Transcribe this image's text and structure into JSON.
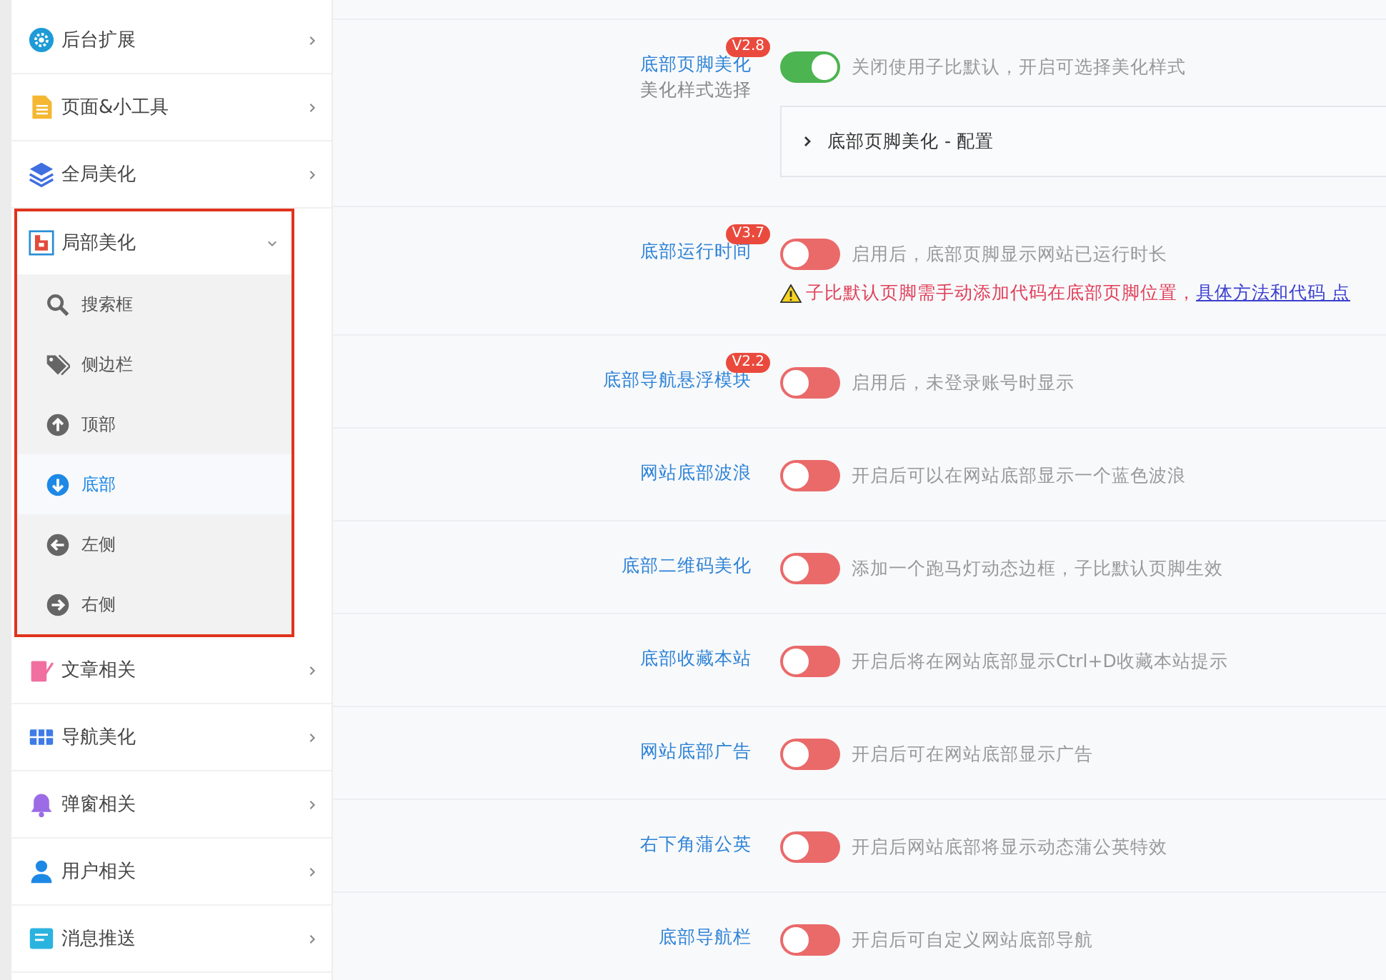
{
  "sidebar": {
    "items": [
      {
        "label": "后台扩展",
        "kind": "gear",
        "expanded": false
      },
      {
        "label": "页面&小工具",
        "kind": "doc",
        "expanded": false
      },
      {
        "label": "全局美化",
        "kind": "layers",
        "expanded": false
      },
      {
        "label": "局部美化",
        "kind": "frame",
        "expanded": true,
        "children": [
          {
            "label": "搜索框",
            "kind": "search",
            "selected": false
          },
          {
            "label": "侧边栏",
            "kind": "tag",
            "selected": false
          },
          {
            "label": "顶部",
            "kind": "up",
            "selected": false
          },
          {
            "label": "底部",
            "kind": "down",
            "selected": true
          },
          {
            "label": "左侧",
            "kind": "left",
            "selected": false
          },
          {
            "label": "右侧",
            "kind": "right",
            "selected": false
          }
        ]
      },
      {
        "label": "文章相关",
        "kind": "note",
        "expanded": false
      },
      {
        "label": "导航美化",
        "kind": "grid",
        "expanded": false
      },
      {
        "label": "弹窗相关",
        "kind": "bell",
        "expanded": false
      },
      {
        "label": "用户相关",
        "kind": "user",
        "expanded": false
      },
      {
        "label": "消息推送",
        "kind": "msg",
        "expanded": false
      }
    ]
  },
  "settings": [
    {
      "label": "底部页脚美化",
      "badge": "V2.8",
      "sublabel": "美化样式选择",
      "on": true,
      "description": "关闭使用子比默认，开启可选择美化样式",
      "panel": "底部页脚美化 - 配置"
    },
    {
      "label": "底部运行时间",
      "badge": "V3.7",
      "on": false,
      "description": "启用后，底部页脚显示网站已运行时长",
      "warning": "子比默认页脚需手动添加代码在底部页脚位置，",
      "warning_link": "具体方法和代码 点"
    },
    {
      "label": "底部导航悬浮模块",
      "badge": "V2.2",
      "on": false,
      "description": "启用后，未登录账号时显示"
    },
    {
      "label": "网站底部波浪",
      "on": false,
      "description": "开启后可以在网站底部显示一个蓝色波浪"
    },
    {
      "label": "底部二维码美化",
      "on": false,
      "description": "添加一个跑马灯动态边框，子比默认页脚生效"
    },
    {
      "label": "底部收藏本站",
      "on": false,
      "description": "开启后将在网站底部显示Ctrl+D收藏本站提示"
    },
    {
      "label": "网站底部广告",
      "on": false,
      "description": "开启后可在网站底部显示广告"
    },
    {
      "label": "右下角蒲公英",
      "on": false,
      "description": "开启后网站底部将显示动态蒲公英特效"
    },
    {
      "label": "底部导航栏",
      "on": false,
      "description": "开启后可自定义网站底部导航"
    }
  ]
}
